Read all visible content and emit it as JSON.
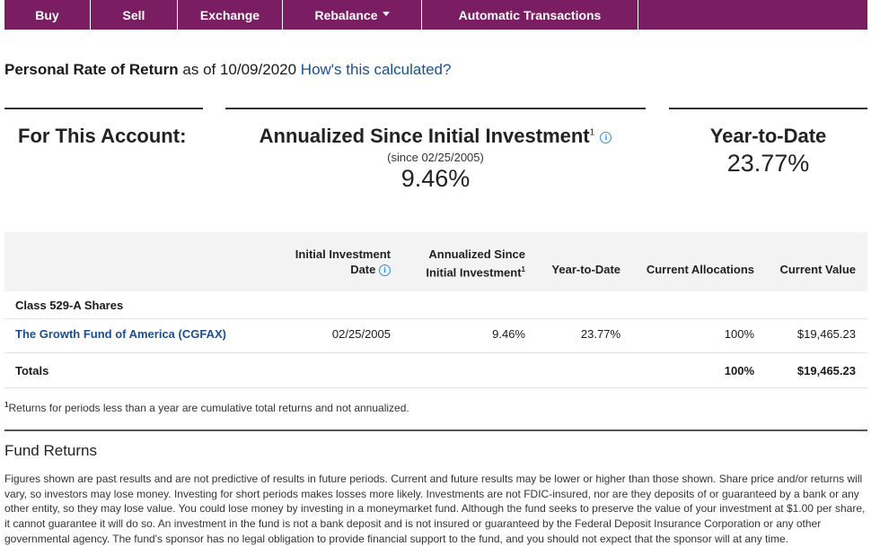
{
  "nav": {
    "items": [
      {
        "label": "Buy"
      },
      {
        "label": "Sell"
      },
      {
        "label": "Exchange"
      },
      {
        "label": "Rebalance"
      },
      {
        "label": "Automatic Transactions"
      }
    ]
  },
  "header": {
    "title_bold": "Personal Rate of Return",
    "as_of": "as of 10/09/2020",
    "link": "How's this calculated?"
  },
  "summary": {
    "account_label": "For This Account:",
    "annualized_title": "Annualized Since Initial Investment",
    "annualized_sup": "1",
    "annualized_since": "(since 02/25/2005)",
    "annualized_value": "9.46%",
    "ytd_title": "Year-to-Date",
    "ytd_value": "23.77%"
  },
  "table": {
    "headers": {
      "initial_date_l1": "Initial Investment",
      "initial_date_l2": "Date",
      "annualized_l1": "Annualized Since",
      "annualized_l2": "Initial Investment",
      "annualized_sup": "1",
      "ytd": "Year-to-Date",
      "allocations": "Current Allocations",
      "value": "Current Value"
    },
    "group_label": "Class 529-A Shares",
    "rows": [
      {
        "fund": "The Growth Fund of America (CGFAX)",
        "initial_date": "02/25/2005",
        "annualized": "9.46%",
        "ytd": "23.77%",
        "allocation": "100%",
        "value": "$19,465.23"
      }
    ],
    "totals": {
      "label": "Totals",
      "allocation": "100%",
      "value": "$19,465.23"
    }
  },
  "footnote": {
    "sup": "1",
    "text": "Returns for periods less than a year are cumulative total returns and not annualized."
  },
  "fund_returns": {
    "title": "Fund Returns",
    "text": "Figures shown are past results and are not predictive of results in future periods. Current and future results may be lower or higher than those shown. Share price and/or returns will vary, so investors may lose money. Investing for short periods makes losses more likely. Investments are not FDIC-insured, nor are they deposits of or guaranteed by a bank or any other entity, so they may lose value. You could lose money by investing in a moneymarket fund. Although the fund seeks to preserve the value of your investment at $1.00 per share, it cannot guarantee it will do so. An investment in the fund is not a bank deposit and is not insured or guaranteed by the Federal Deposit Insurance Corporation or any other governmental agency. The fund's sponsor has no legal obligation to provide financial support to the fund, and you should not expect that the sponsor will at any time."
  },
  "icons": {
    "info": "info-icon",
    "caret": "chevron-down-icon"
  },
  "colors": {
    "nav_bg": "#7a1d62",
    "link": "#1d4f8c",
    "info_icon": "#2a8fd6",
    "table_header_bg": "#f3f3f3"
  }
}
